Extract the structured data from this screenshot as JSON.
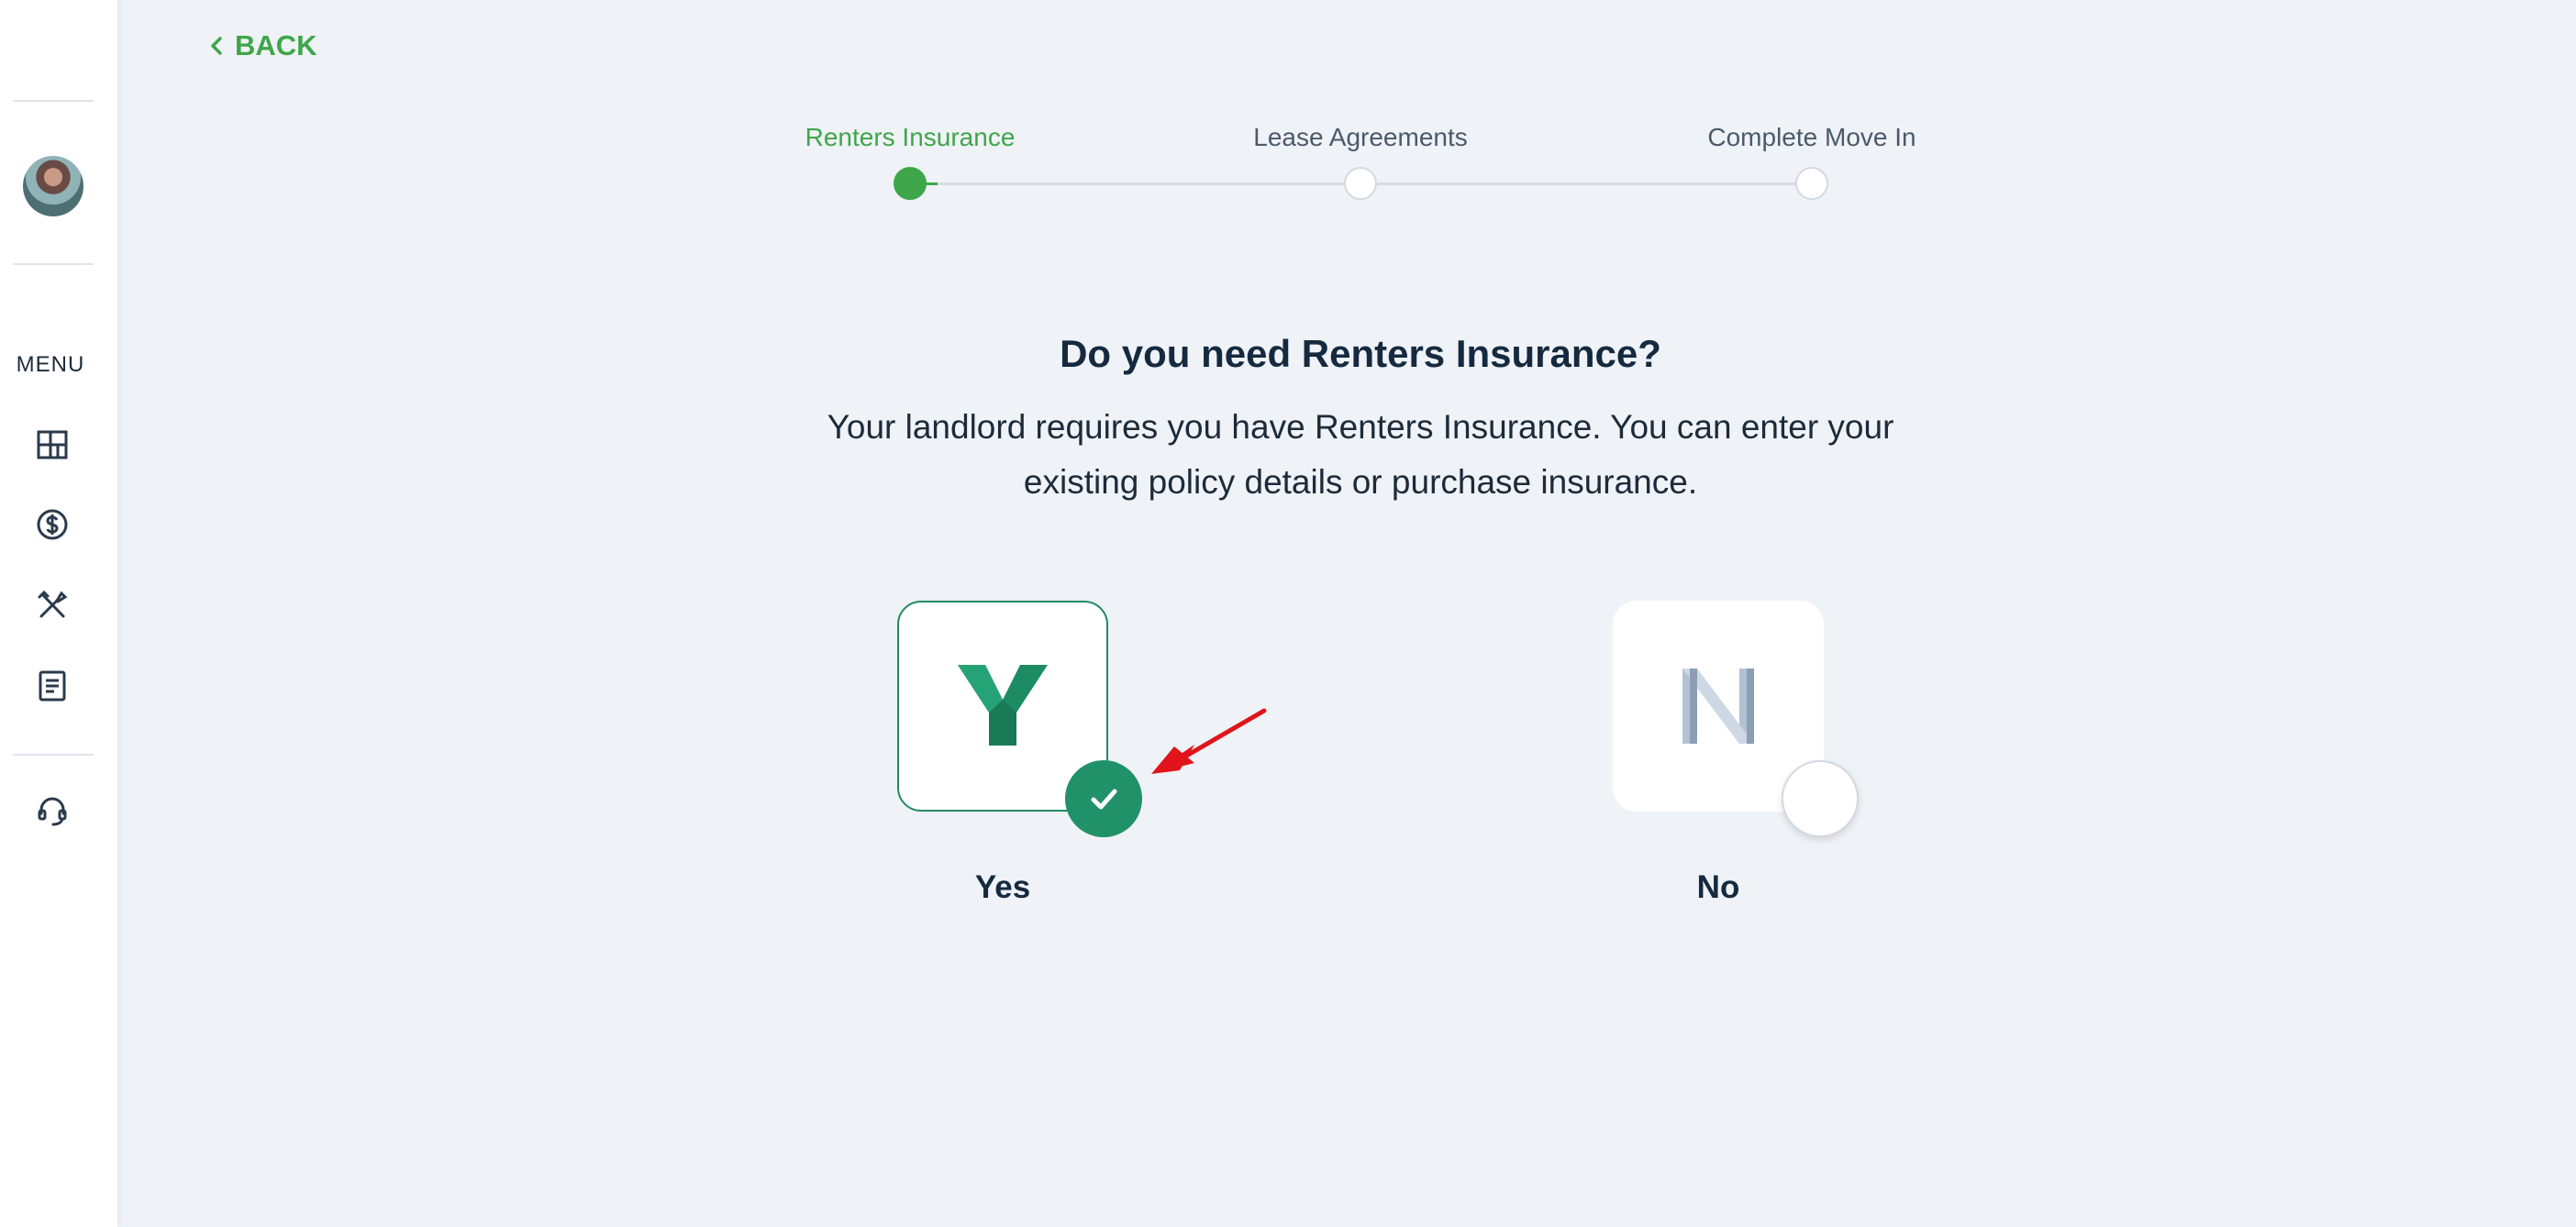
{
  "nav": {
    "back_label": "BACK",
    "menu_label": "MENU",
    "icons": [
      "dashboard-icon",
      "payments-icon",
      "maintenance-icon",
      "documents-icon",
      "support-icon"
    ]
  },
  "stepper": {
    "steps": [
      {
        "label": "Renters Insurance",
        "state": "active"
      },
      {
        "label": "Lease Agreements",
        "state": "pending"
      },
      {
        "label": "Complete Move In",
        "state": "pending"
      }
    ]
  },
  "main": {
    "question": "Do you need Renters Insurance?",
    "subtitle": "Your landlord requires you have Renters Insurance. You can enter your existing policy details or purchase insurance."
  },
  "options": [
    {
      "letter": "Y",
      "label": "Yes",
      "selected": true
    },
    {
      "letter": "N",
      "label": "No",
      "selected": false
    }
  ],
  "colors": {
    "accent_green": "#3fa64a",
    "selected_teal": "#21916a",
    "background": "#eff2f7",
    "annotation_arrow": "#e0141a"
  }
}
